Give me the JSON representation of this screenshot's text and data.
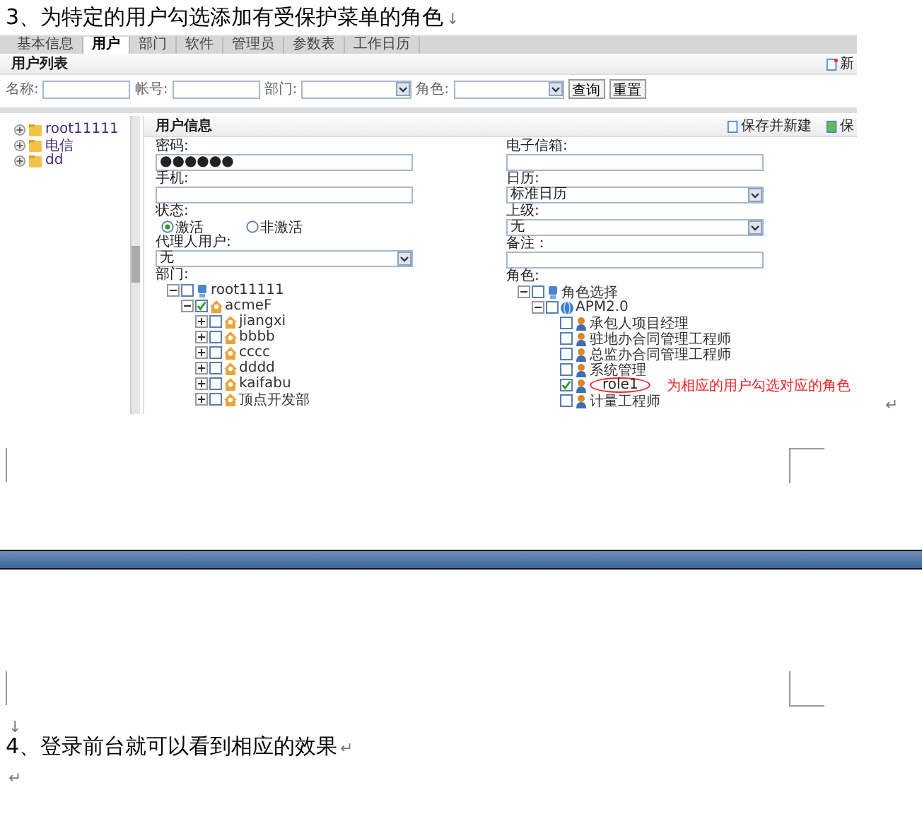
{
  "heading_3": {
    "text": "3、为特定的用户勾选添加有受保护菜单的角色",
    "mark": "↓"
  },
  "screenshot": {
    "tabs": [
      {
        "label": "基本信息",
        "selected": false
      },
      {
        "label": "用户",
        "selected": true
      },
      {
        "label": "部门",
        "selected": false
      },
      {
        "label": "软件",
        "selected": false
      },
      {
        "label": "管理员",
        "selected": false
      },
      {
        "label": "参数表",
        "selected": false
      },
      {
        "label": "工作日历",
        "selected": false
      }
    ],
    "list_title": "用户列表",
    "new_button": "新",
    "filters": [
      {
        "kind": "input",
        "label": "名称:"
      },
      {
        "kind": "input",
        "label": "帐号:"
      },
      {
        "kind": "select",
        "label": "部门:"
      },
      {
        "kind": "select",
        "label": "角色:"
      }
    ],
    "buttons": [
      "查询",
      "重置"
    ],
    "sidebar_tree": [
      {
        "label": "root11111"
      },
      {
        "label": "电信"
      },
      {
        "label": "dd"
      }
    ],
    "form_title": "用户信息",
    "actions": [
      "保存并新建",
      "保"
    ],
    "left_fields": [
      {
        "kind": "input",
        "label": "密码:",
        "value": "●●●●●●"
      },
      {
        "kind": "input",
        "label": "手机:"
      },
      {
        "kind": "radio",
        "label": "状态:",
        "options": [
          {
            "label": "激活",
            "selected": true
          },
          {
            "label": "非激活",
            "selected": false
          }
        ]
      },
      {
        "kind": "select",
        "label": "代理人用户:",
        "value": "无"
      },
      {
        "kind": "tree",
        "label": "部门:",
        "tree": [
          {
            "kind": "root",
            "label": "root11111",
            "checked": false,
            "expanded": true,
            "children": [
              {
                "kind": "org",
                "label": "acmeF",
                "checked": true,
                "expanded": true,
                "children": [
                  {
                    "kind": "org",
                    "label": "jiangxi",
                    "checked": false,
                    "expanded": false
                  },
                  {
                    "kind": "org",
                    "label": "bbbb",
                    "checked": false,
                    "expanded": false
                  },
                  {
                    "kind": "org",
                    "label": "cccc",
                    "checked": false,
                    "expanded": false
                  },
                  {
                    "kind": "org",
                    "label": "dddd",
                    "checked": false,
                    "expanded": false
                  },
                  {
                    "kind": "org",
                    "label": "kaifabu",
                    "checked": false,
                    "expanded": false
                  },
                  {
                    "kind": "org",
                    "label": "顶点开发部",
                    "checked": false,
                    "expanded": false
                  }
                ]
              }
            ]
          }
        ]
      }
    ],
    "right_fields": [
      {
        "kind": "input",
        "label": "电子信箱:"
      },
      {
        "kind": "select",
        "label": "日历:",
        "value": "标准日历"
      },
      {
        "kind": "select",
        "label": "上级:",
        "value": "无"
      },
      {
        "kind": "input",
        "label": "备注："
      },
      {
        "kind": "tree",
        "label": "角色:",
        "tree": [
          {
            "kind": "root",
            "label": "角色选择",
            "checked": false,
            "expanded": true,
            "children": [
              {
                "kind": "app",
                "label": "APM2.0",
                "checked": false,
                "expanded": true,
                "children": [
                  {
                    "kind": "role",
                    "label": "承包人项目经理",
                    "checked": false
                  },
                  {
                    "kind": "role",
                    "label": "驻地办合同管理工程师",
                    "checked": false
                  },
                  {
                    "kind": "role",
                    "label": "总监办合同管理工程师",
                    "checked": false
                  },
                  {
                    "kind": "role",
                    "label": "系统管理",
                    "checked": false
                  },
                  {
                    "kind": "role",
                    "label": "role1",
                    "checked": true,
                    "note": "为相应的用户勾选对应的角色"
                  },
                  {
                    "kind": "role",
                    "label": "计量工程师",
                    "checked": false
                  }
                ]
              }
            ]
          }
        ]
      }
    ]
  },
  "screenshot_mark": "↵",
  "empty_line_mark": "↓",
  "heading_4": {
    "text": "4、登录前台就可以看到相应的效果",
    "mark": "↵"
  },
  "end_mark": "↵"
}
